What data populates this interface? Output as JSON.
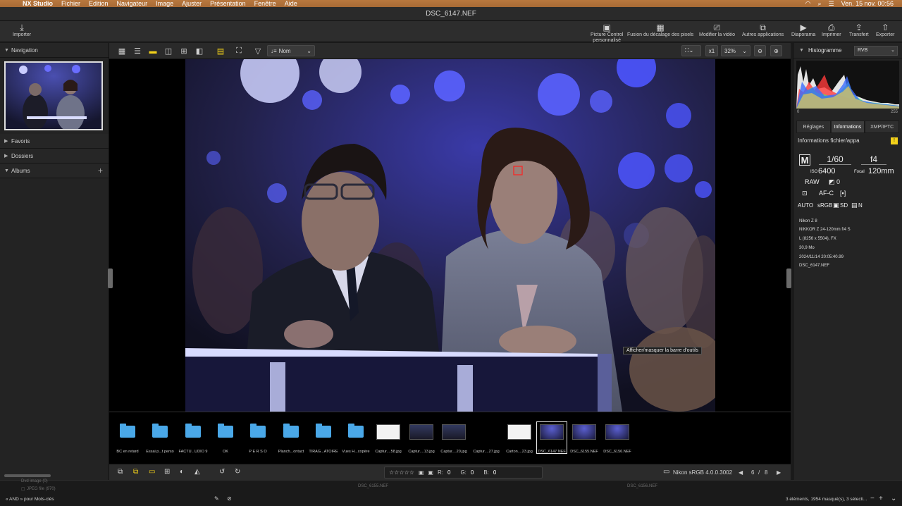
{
  "menubar": {
    "app": "NX Studio",
    "items": [
      "Fichier",
      "Edition",
      "Navigateur",
      "Image",
      "Ajuster",
      "Présentation",
      "Fenêtre",
      "Aide"
    ],
    "datetime": "Ven. 15 nov.  00:56"
  },
  "window": {
    "title": "DSC_6147.NEF"
  },
  "toolbar": {
    "import": "Importer",
    "picture_control_1": "Picture Control",
    "picture_control_2": "personnalisé",
    "pixel_shift": "Fusion du décalage des pixels",
    "edit_video": "Modifier la vidéo",
    "other_apps": "Autres applications",
    "slideshow": "Diaporama",
    "print": "Imprimer",
    "transfer": "Transfert",
    "export": "Exporter"
  },
  "left_panel": {
    "navigation": "Navigation",
    "favorites": "Favoris",
    "folders": "Dossiers",
    "albums": "Albums"
  },
  "viewer_bar": {
    "sort": "Nom",
    "zoom_ratio": "x1",
    "zoom": "32%"
  },
  "viewer": {
    "tooltip": "Afficher/masquer la barre d'outils"
  },
  "filmstrip": [
    {
      "label": "BC en retard",
      "kind": "folder"
    },
    {
      "label": "Essai p...t perso",
      "kind": "folder"
    },
    {
      "label": "FACTU...UDIO 9",
      "kind": "folder"
    },
    {
      "label": "OK",
      "kind": "folder"
    },
    {
      "label": "P E R S O",
      "kind": "folder"
    },
    {
      "label": "Planch...ontact",
      "kind": "folder"
    },
    {
      "label": "TIRAG...ATOIRE",
      "kind": "folder"
    },
    {
      "label": "Vues H...copère",
      "kind": "folder"
    },
    {
      "label": "Captur....58.jpg",
      "kind": "white"
    },
    {
      "label": "Captur....13.jpg",
      "kind": "dark"
    },
    {
      "label": "Captur....20.jpg",
      "kind": "dark"
    },
    {
      "label": "Captur....27.jpg",
      "kind": "blank"
    },
    {
      "label": "Carton....23.jpg",
      "kind": "white"
    },
    {
      "label": "DSC_6147.NEF",
      "kind": "photo",
      "selected": true
    },
    {
      "label": "DSC_6155.NEF",
      "kind": "photo"
    },
    {
      "label": "DSC_6156.NEF",
      "kind": "photo"
    }
  ],
  "bottom_bar": {
    "r_label": "R:",
    "r_value": "0",
    "g_label": "G:",
    "g_value": "0",
    "b_label": "B:",
    "b_value": "0",
    "profile": "Nikon sRGB 4.0.0.3002",
    "page_current": "6",
    "page_sep": "/",
    "page_total": "8"
  },
  "right_panel": {
    "histogram": "Histogramme",
    "channel": "RVB",
    "hist_min": "0",
    "hist_max": "255",
    "tabs": [
      "Réglages",
      "Informations",
      "XMP/IPTC"
    ],
    "active_tab": "Informations",
    "info_header": "Informations fichier/appa",
    "exposure": {
      "mode": "M",
      "shutter": "1/60",
      "aperture": "f4",
      "iso_label": "ISO",
      "iso": "6400",
      "focal_label": "Focal",
      "focal": "120mm",
      "quality": "RAW",
      "exp_comp": "0",
      "af": "AF-C",
      "wb": "AUTO",
      "color_space": "sRGB",
      "picture": "SD",
      "extra": "N"
    },
    "details": [
      "Nikon Z 8",
      "NIKKOR Z 24-120mm f/4 S",
      "L (8256 x 5504), FX",
      "30,9 Mo",
      "2024/11/14 20:05:40.99",
      "DSC_6147.NEF"
    ]
  },
  "background": {
    "img1": "DSC_6155.NEF",
    "img2": "DSC_6156.NEF",
    "left_row1": "Dvd image  (0)",
    "left_row2": "JPEG file  (970)",
    "keywords_hint": "« AND » pour Mots-clés",
    "selection_status": "3 éléments, 1954 masqué(s), 3 sélecti..."
  }
}
